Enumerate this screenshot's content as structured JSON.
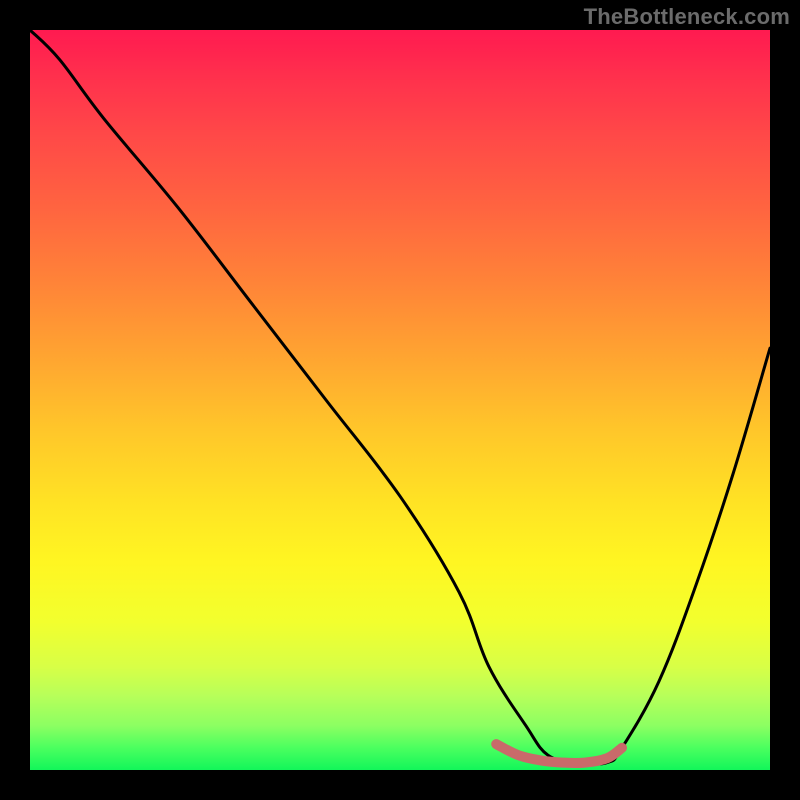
{
  "watermark": "TheBottleneck.com",
  "chart_data": {
    "type": "line",
    "title": "",
    "xlabel": "",
    "ylabel": "",
    "xlim": [
      0,
      100
    ],
    "ylim": [
      0,
      100
    ],
    "gradient_colors": {
      "top": "#ff1a50",
      "upper_mid": "#ff8338",
      "mid": "#ffe324",
      "lower_mid": "#d8ff46",
      "bottom": "#12f65a"
    },
    "series": [
      {
        "name": "bottleneck-curve",
        "color": "#000000",
        "x": [
          0,
          4,
          10,
          20,
          30,
          40,
          50,
          58,
          62,
          67,
          70,
          74,
          78,
          80,
          85,
          90,
          95,
          100
        ],
        "y": [
          100,
          96,
          88,
          76,
          63,
          50,
          37,
          24,
          14,
          6,
          2,
          1,
          1,
          3,
          12,
          25,
          40,
          57
        ]
      },
      {
        "name": "optimal-range-marker",
        "color": "#c96a6a",
        "x": [
          63,
          66,
          69,
          72,
          75,
          78,
          80
        ],
        "y": [
          3.5,
          2.0,
          1.3,
          1.0,
          1.0,
          1.6,
          3.0
        ]
      }
    ],
    "optimal_range": {
      "x_start": 63,
      "x_end": 80
    }
  }
}
